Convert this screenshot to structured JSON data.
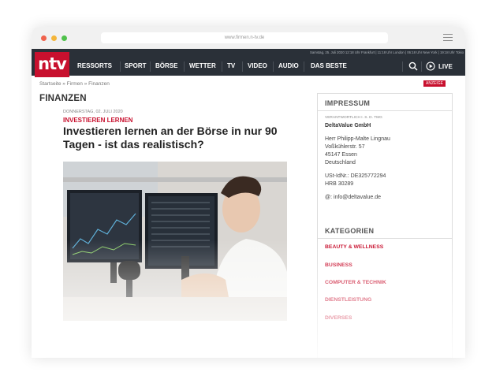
{
  "browser": {
    "url": "www.firmen.n-tv.de"
  },
  "header": {
    "logo_text": "ntv",
    "status_line": "Samstag, 25. Juli 2020 12:18 Uhr Frankfurt | 11:18 Uhr London | 06:18 Uhr New York | 19:18 Uhr Tokio",
    "nav": [
      "RESSORTS",
      "SPORT",
      "BÖRSE",
      "WETTER",
      "TV",
      "VIDEO",
      "AUDIO",
      "DAS BESTE"
    ],
    "live_label": "LIVE"
  },
  "breadcrumb": "Startseite » Firmen » Finanzen",
  "anzeige": "ANZEIGE",
  "section_title": "FINANZEN",
  "article": {
    "date": "DONNERSTAG, 02. JULI 2020",
    "kicker": "INVESTIEREN LERNEN",
    "headline": "Investieren lernen an der Börse in nur 90 Tagen - ist das realistisch?"
  },
  "sidebar": {
    "impressum_title": "IMPRESSUM",
    "responsible_label": "VERANTWORTLICH I. S. D. TMG",
    "company": "DeltaValue GmbH",
    "person": "Herr Philipp-Malte Lingnau",
    "street": "Voßkühlerstr. 57",
    "city": "45147 Essen",
    "country": "Deutschland",
    "ust": "USt-IdNr.: DE325772294",
    "hrb": "HRB 30289",
    "email": "@: info@deltavalue.de",
    "categories_title": "KATEGORIEN",
    "categories": [
      "BEAUTY & WELLNESS",
      "BUSINESS",
      "COMPUTER & TECHNIK",
      "DIENSTLEISTUNG",
      "DIVERSES"
    ]
  },
  "colors": {
    "brand_red": "#c8102e",
    "nav_bg": "#2a3038"
  }
}
